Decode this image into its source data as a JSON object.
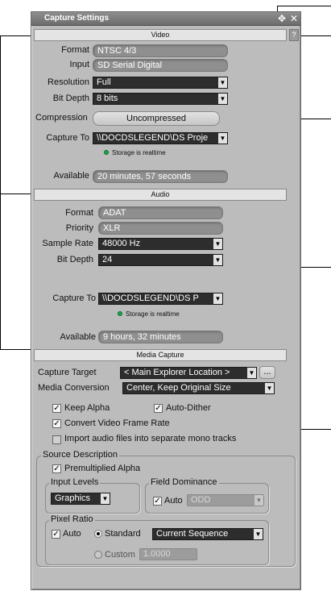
{
  "window": {
    "title": "Capture Settings"
  },
  "sections": {
    "video": "Video",
    "audio": "Audio",
    "media_capture": "Media Capture"
  },
  "video": {
    "format_label": "Format",
    "format_value": "NTSC 4/3",
    "input_label": "Input",
    "input_value": "SD Serial Digital",
    "resolution_label": "Resolution",
    "resolution_value": "Full",
    "bitdepth_label": "Bit Depth",
    "bitdepth_value": "8 bits",
    "compression_label": "Compression",
    "compression_value": "Uncompressed",
    "capture_to_label": "Capture To",
    "capture_to_value": "\\\\DOCDSLEGEND\\DS Proje",
    "storage_status": "Storage is realtime",
    "available_label": "Available",
    "available_value": "20 minutes, 57 seconds"
  },
  "audio": {
    "format_label": "Format",
    "format_value": "ADAT",
    "priority_label": "Priority",
    "priority_value": "XLR",
    "samplerate_label": "Sample Rate",
    "samplerate_value": "48000 Hz",
    "bitdepth_label": "Bit Depth",
    "bitdepth_value": "24",
    "capture_to_label": "Capture To",
    "capture_to_value": "\\\\DOCDSLEGEND\\DS P",
    "storage_status": "Storage is realtime",
    "available_label": "Available",
    "available_value": "9 hours, 32 minutes"
  },
  "media": {
    "target_label": "Capture Target",
    "target_value": "< Main Explorer Location >",
    "browse_label": "...",
    "conversion_label": "Media Conversion",
    "conversion_value": "Center, Keep Original Size",
    "keep_alpha": "Keep Alpha",
    "auto_dither": "Auto-Dither",
    "convert_rate": "Convert Video Frame Rate",
    "import_mono": "Import audio files into separate mono tracks"
  },
  "source": {
    "title": "Source Description",
    "premultiplied": "Premultiplied Alpha",
    "input_levels_title": "Input Levels",
    "input_levels_value": "Graphics",
    "field_dominance_title": "Field Dominance",
    "field_auto": "Auto",
    "field_value": "ODD",
    "pixel_ratio_title": "Pixel Ratio",
    "pixel_auto": "Auto",
    "standard_label": "Standard",
    "standard_value": "Current Sequence",
    "custom_label": "Custom",
    "custom_value": "1.0000"
  },
  "colors": {
    "panel": "#bcbcbc",
    "dropdown": "#2d2d2d",
    "field": "#8f8f8f",
    "led": "#19a64a"
  }
}
